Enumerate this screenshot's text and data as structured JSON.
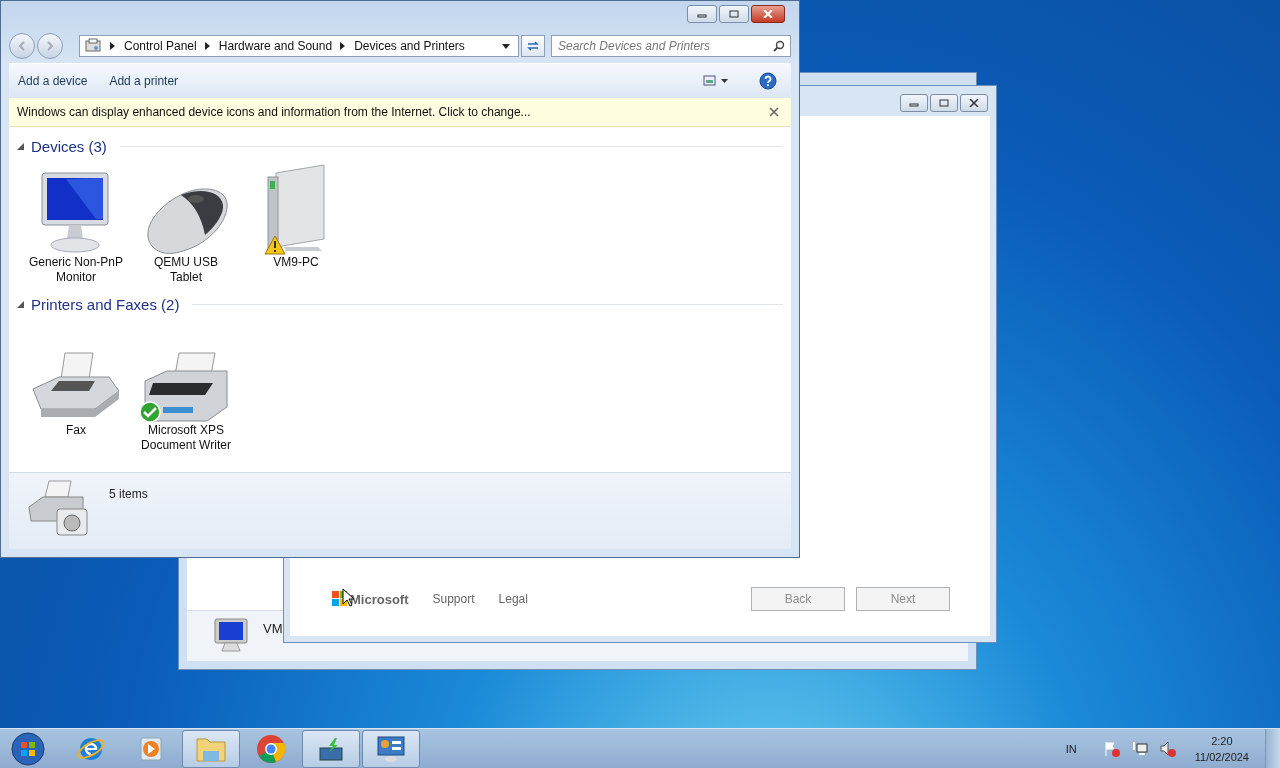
{
  "back_window": {
    "label": "VM"
  },
  "setup_window": {
    "logo_text": "Microsoft",
    "footer_links": [
      "Support",
      "Legal"
    ],
    "buttons": [
      {
        "label": "Back",
        "disabled": true
      },
      {
        "label": "Next",
        "disabled": true
      }
    ]
  },
  "main_window": {
    "breadcrumb": [
      "Control Panel",
      "Hardware and Sound",
      "Devices and Printers"
    ],
    "search": {
      "placeholder": "Search Devices and Printers"
    },
    "commands": [
      "Add a device",
      "Add a printer"
    ],
    "info_bar": "Windows can display enhanced device icons and information from the Internet. Click to change...",
    "groups": [
      {
        "title": "Devices (3)",
        "expanded": true,
        "items": [
          {
            "label": "Generic Non-PnP Monitor",
            "kind": "monitor",
            "warning": false,
            "is_default": false
          },
          {
            "label": "QEMU USB Tablet",
            "kind": "mouse",
            "warning": false,
            "is_default": false
          },
          {
            "label": "VM9-PC",
            "kind": "computer",
            "warning": true,
            "is_default": false
          }
        ]
      },
      {
        "title": "Printers and Faxes (2)",
        "expanded": true,
        "items": [
          {
            "label": "Fax",
            "kind": "fax",
            "warning": false,
            "is_default": false
          },
          {
            "label": "Microsoft XPS Document Writer",
            "kind": "printer",
            "warning": false,
            "is_default": true
          }
        ]
      }
    ],
    "status": "5 items"
  },
  "taskbar": {
    "apps": [
      {
        "kind": "ie",
        "active": false
      },
      {
        "kind": "media",
        "active": false
      },
      {
        "kind": "explorer",
        "active": true
      },
      {
        "kind": "chrome",
        "active": false
      },
      {
        "kind": "download",
        "active": true
      },
      {
        "kind": "control",
        "active": true
      }
    ],
    "tray": {
      "language": "IN",
      "time": "2:20",
      "date": "11/02/2024"
    }
  }
}
